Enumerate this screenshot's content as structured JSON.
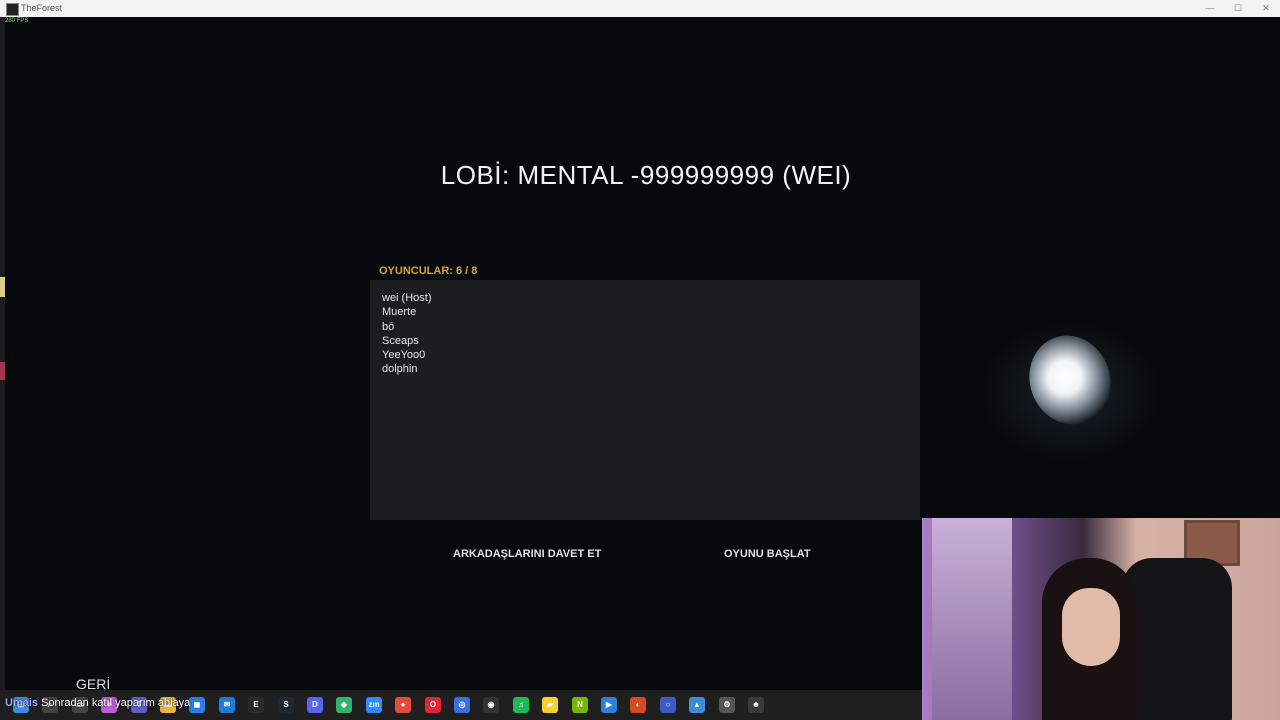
{
  "window": {
    "title": "TheForest",
    "controls": [
      "—",
      "☐",
      "✕"
    ]
  },
  "fps": "280 FPS",
  "lobby": {
    "title": "LOBİ: MENTAL -999999999 (WEI)",
    "players_label": "OYUNCULAR: 6 / 8",
    "players": [
      "wei (Host)",
      "Muerte",
      "bō",
      "Sceaps",
      "YeeYoo0",
      "dolphin"
    ],
    "invite_button": "ARKADAŞLARINI DAVET ET",
    "start_button": "OYUNU BAŞLAT",
    "back_button": "GERİ"
  },
  "caption": {
    "name": "Umais",
    "text": "Sonradan katıl yaparım ablaya"
  },
  "taskbar_icons": [
    {
      "name": "windows-start-icon",
      "color": "#3a8ee6",
      "glyph": "⊞"
    },
    {
      "name": "search-icon",
      "color": "#444",
      "glyph": "⌕"
    },
    {
      "name": "taskview-icon",
      "color": "#444",
      "glyph": "▭"
    },
    {
      "name": "copilot-icon",
      "color": "#c05ad8",
      "glyph": "✦"
    },
    {
      "name": "teams-icon",
      "color": "#5b5fc7",
      "glyph": "T"
    },
    {
      "name": "file-explorer-icon",
      "color": "#e8b43a",
      "glyph": "▬"
    },
    {
      "name": "store-icon",
      "color": "#2b7de0",
      "glyph": "◼"
    },
    {
      "name": "mail-icon",
      "color": "#1f7ad8",
      "glyph": "✉"
    },
    {
      "name": "epic-games-icon",
      "color": "#2a2a2a",
      "glyph": "E"
    },
    {
      "name": "steam-icon",
      "color": "#1b2838",
      "glyph": "S"
    },
    {
      "name": "discord-icon",
      "color": "#5865f2",
      "glyph": "D"
    },
    {
      "name": "app-green-icon",
      "color": "#2db36b",
      "glyph": "◆"
    },
    {
      "name": "zoom-icon",
      "color": "#2d8cff",
      "glyph": "zm"
    },
    {
      "name": "chrome-icon",
      "color": "#e24a3b",
      "glyph": "●"
    },
    {
      "name": "opera-gx-icon",
      "color": "#e0243a",
      "glyph": "O"
    },
    {
      "name": "app-blue-icon",
      "color": "#3a6fe0",
      "glyph": "◎"
    },
    {
      "name": "obs-icon",
      "color": "#333",
      "glyph": "◉"
    },
    {
      "name": "spotify-icon",
      "color": "#1db954",
      "glyph": "♫"
    },
    {
      "name": "sticky-notes-icon",
      "color": "#f7d12a",
      "glyph": "▰"
    },
    {
      "name": "nvidia-icon",
      "color": "#76b900",
      "glyph": "N"
    },
    {
      "name": "app-play-icon",
      "color": "#2f7fe0",
      "glyph": "▶"
    },
    {
      "name": "app-red-icon",
      "color": "#d84a20",
      "glyph": "◐"
    },
    {
      "name": "app-circle-icon",
      "color": "#3a5ac8",
      "glyph": "○"
    },
    {
      "name": "photos-icon",
      "color": "#3a8ed8",
      "glyph": "▲"
    },
    {
      "name": "settings-icon",
      "color": "#555",
      "glyph": "⚙"
    },
    {
      "name": "the-forest-icon",
      "color": "#3a3a3a",
      "glyph": "☻"
    }
  ]
}
